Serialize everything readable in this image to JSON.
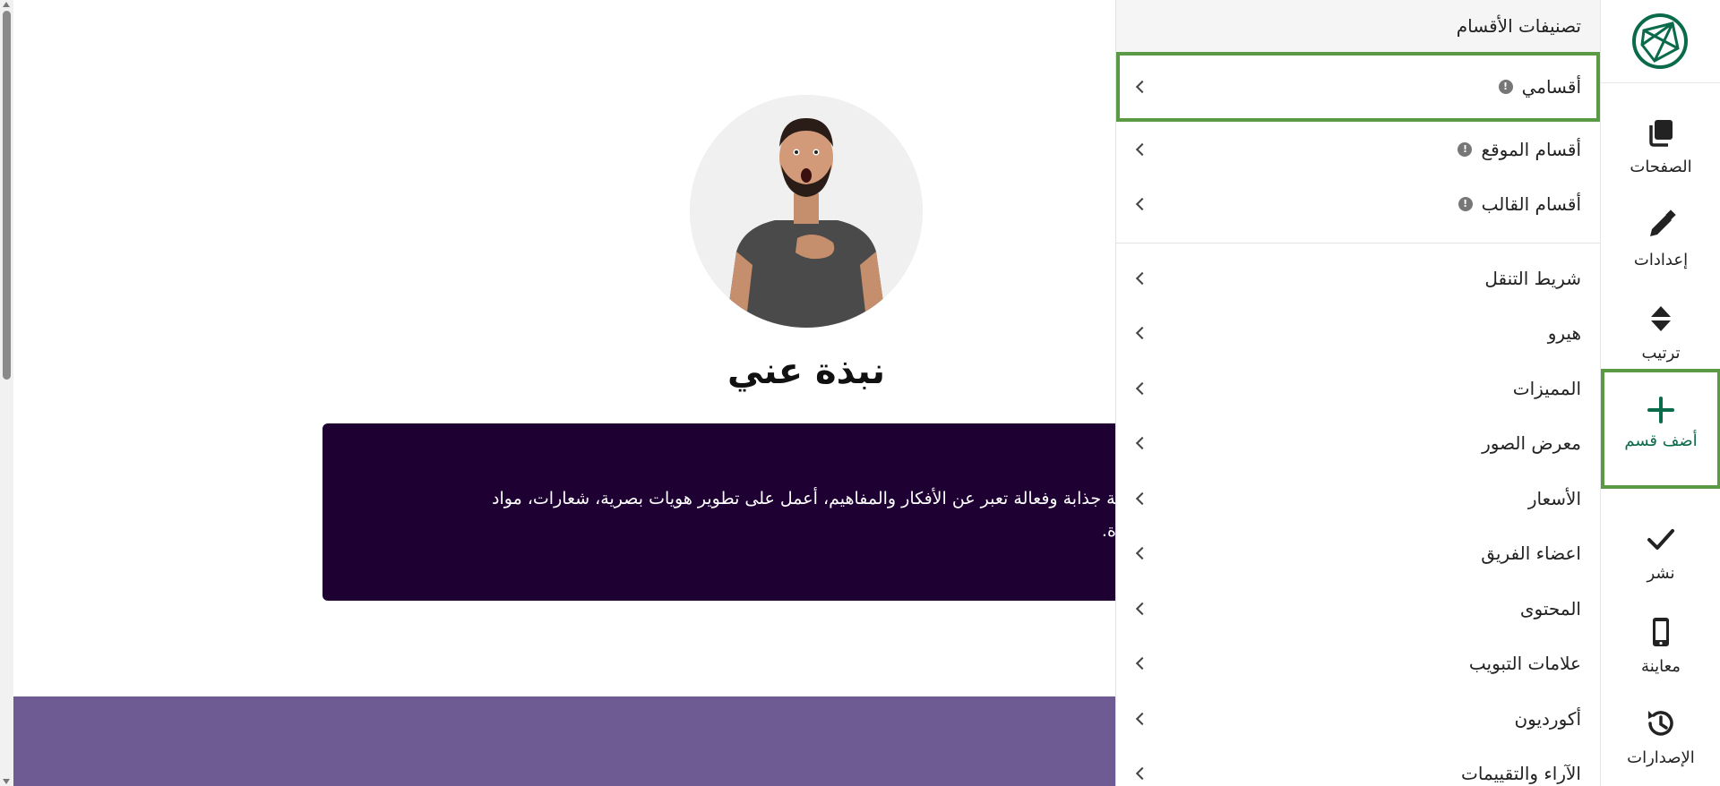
{
  "panel": {
    "header": "تصنيفات الأقسام",
    "saved_groups": [
      {
        "label": "أقسامي"
      },
      {
        "label": "أقسام الموقع"
      },
      {
        "label": "أقسام القالب"
      }
    ],
    "section_types": [
      {
        "label": "شريط التنقل"
      },
      {
        "label": "هيرو"
      },
      {
        "label": "المميزات"
      },
      {
        "label": "معرض الصور"
      },
      {
        "label": "الأسعار"
      },
      {
        "label": "اعضاء الفريق"
      },
      {
        "label": "المحتوى"
      },
      {
        "label": "علامات التبويب"
      },
      {
        "label": "أكورديون"
      },
      {
        "label": "الآراء والتقييمات"
      }
    ]
  },
  "rail": {
    "items": [
      {
        "label": "الصفحات",
        "icon": "pages-icon"
      },
      {
        "label": "إعدادات",
        "icon": "pencil-icon"
      },
      {
        "label": "ترتيب",
        "icon": "sort-icon"
      },
      {
        "label": "أضف قسم",
        "icon": "plus-icon"
      },
      {
        "label": "نشر",
        "icon": "check-icon"
      },
      {
        "label": "معاينة",
        "icon": "mobile-icon"
      },
      {
        "label": "الإصدارات",
        "icon": "history-icon"
      }
    ]
  },
  "canvas": {
    "section_title": "نبذة عني",
    "bio_line_1": "تصاميم بصرية جذابة وفعالة تعبر عن الأفكار والمفاهيم، أعمل على تطوير هويات بصرية، شعارات، مواد",
    "bio_line_2": "ستخدم مميزة."
  },
  "colors": {
    "accent": "#0a6b4b",
    "highlight": "#5b9a45",
    "bio_bg": "#1e0033",
    "band": "#6f5b93"
  }
}
